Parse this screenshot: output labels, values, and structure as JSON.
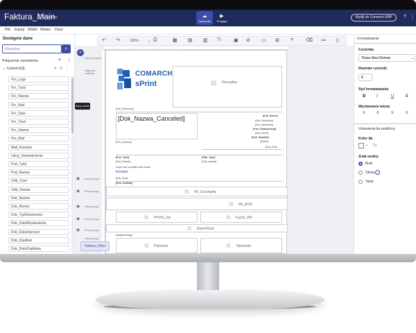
{
  "app": {
    "title": "Faktura_Main",
    "saved_status": "Zapisano",
    "modes": [
      "Tworzenie",
      "Podgląd"
    ],
    "send_button": "Wyślij do Comarch ERP",
    "help_icon": "help-circle-icon"
  },
  "menu": [
    "Plik",
    "Edytuj",
    "Widok",
    "Wstaw",
    "Dane"
  ],
  "left_panel": {
    "title": "Dostępne dane",
    "search_placeholder": "Wyszukaj",
    "connections_label": "Połączenie zasmętoma",
    "source": "CustomSQL",
    "fields": [
      "Firr_Logo",
      "Firr_Tytul",
      "Firr_Nazwa",
      "Firr_Mail",
      "Firr_Opis",
      "Firr_Tytul",
      "Firr_Nazwa",
      "Firr_Mail",
      "Mail_Kasowa",
      "Ukryj_Owniadczenia",
      "Pod_Tytul",
      "Pod_Nazwa",
      "Odb_Tytul",
      "Odb_Nazwa",
      "Dok_Nazwa",
      "Dok_Numer",
      "Dok_TypDokumentu",
      "Dok_DataWystawienia",
      "Dok_DataOperacji",
      "Dok_Duplikat",
      "Dok_DataDuplikatu"
    ]
  },
  "bands": [
    "Górny margines",
    "Nagłówek szablonu",
    "Stopka grupy",
    "Stopka grupy",
    "Stopka grupy",
    "Stopka grupy",
    "Stopka grupy",
    "Stopka grupy"
  ],
  "tooltip": "Ikony rozwiń",
  "toolbar": {
    "zoom": "100%"
  },
  "report": {
    "logo_top": "COMARCH",
    "logo_bottom": "sPrint",
    "stamp": "Pieczątka",
    "dok_rachunek": "[Dok_Rachunek]",
    "dok_nazwa_canceled": "[Dok_Nazwa_Canceled]",
    "pod_kasowa": "[Pod_Kasowa]",
    "dok_numer": "[Dok_Numer]",
    "right_fields": [
      "[Dok_Zawartosc]",
      "[Dok_Zawartosc]",
      "[Dok_Zawartosc]",
      "[Dok_Zawartosc]"
    ],
    "pow_operacji": "[Pow_DataOperacji]",
    "dok_zwrot": "[Dok_Zwrot]",
    "dok_duplikat": "[Dok_Duplikat]",
    "numer": "[Numer]",
    "bottom_right": "[Dok_Pos]",
    "pod_tytul": "[Pod_Tytul]",
    "pod_nazwa": "[Pod_Nazwa]",
    "odb_tytul": "[Odb_Tytul]",
    "odb_nazwa": "[Odb_Nazwa]",
    "note": "Kopię oraz produkty które zmian",
    "link": "Kontakt",
    "dok_ilosc": "[Dok_Ilosc]",
    "dok_kodnabywcy": "[Dok_KodNab]",
    "szczegoly": "FA_Szczegóły",
    "kon": "FA_KON",
    "pkon_zal": "PKON_Zal",
    "fazal_vat": "FaZal_VAT",
    "elem_fazal": "ElemFAZal",
    "notatka": "Notatka/Uwaga",
    "platnosci": "Płatności",
    "tabela_vat": "TabelaVat"
  },
  "right_panel": {
    "title": "Formatowanie",
    "font_label": "Czcionka",
    "font_value": "Times New Roman",
    "size_label": "Rozmiar czcionki",
    "size_value": "8",
    "style_label": "Styl formatowania",
    "styles": [
      "B",
      "I",
      "U",
      "T"
    ],
    "align_label": "Wyrównanie tekstu",
    "settings_label": "Ustawienia tła szablonu",
    "bg_color_label": "Kolor tła",
    "bg_color_value": "Tło",
    "watermark_label": "Znak wodny",
    "watermark_options": [
      "Brak",
      "Obraz",
      "Tekst"
    ],
    "watermark_selected": "Brak"
  },
  "bottom_tab": "Faktura_Main",
  "colors": {
    "topbar": "#1f2b58",
    "accent": "#3d4ea8",
    "logo_blue": "#1e5fb3"
  }
}
